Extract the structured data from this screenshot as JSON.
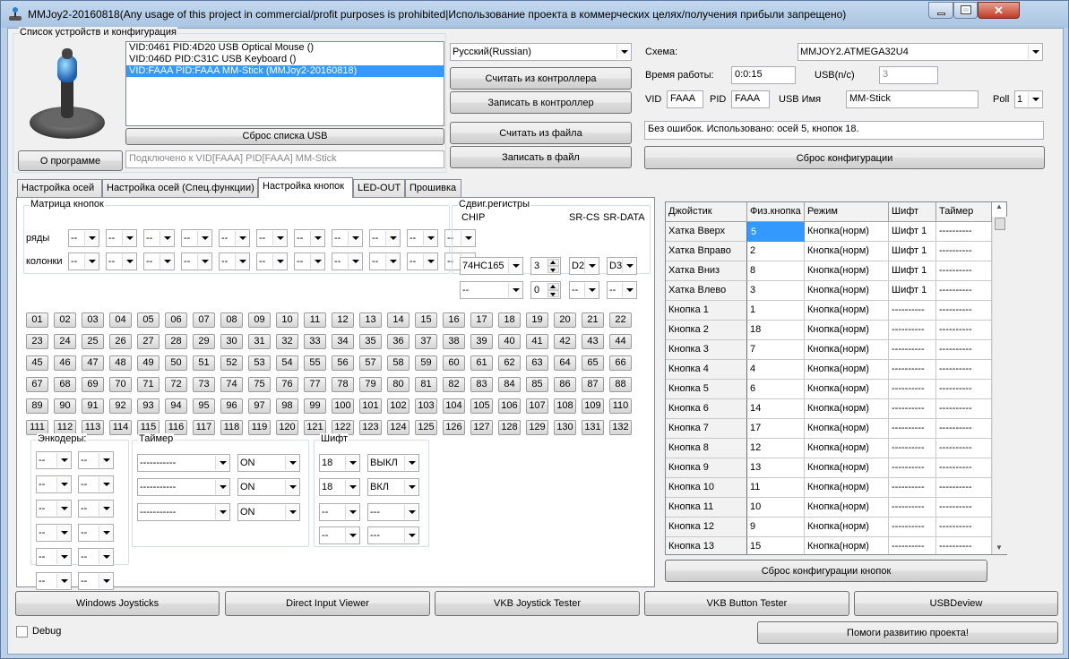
{
  "window": {
    "title": "MMJoy2-20160818(Any usage of this project in commercial/profit purposes is prohibited|Использование проекта в коммерческих целях/получения прибыли запрещено)"
  },
  "devices": {
    "group_title": "Список устройств и конфигурация",
    "list": [
      "VID:0461 PID:4D20 USB Optical Mouse ()",
      "VID:046D PID:C31C USB Keyboard ()",
      "VID:FAAA PID:FAAA MM-Stick (MMJoy2-20160818)"
    ],
    "selected_index": 2,
    "reset_usb_label": "Сброс списка USB",
    "about_label": "О программе",
    "status_text": "Подключено к VID[FAAA] PID[FAAA] MM-Stick"
  },
  "controller": {
    "language": "Русский(Russian)",
    "read_controller": "Считать из контроллера",
    "write_controller": "Записать в контроллер",
    "read_file": "Считать из файла",
    "write_file": "Записать в файл"
  },
  "config": {
    "scheme_label": "Схема:",
    "scheme_value": "MMJOY2.ATMEGA32U4",
    "uptime_label": "Время работы:",
    "uptime_value": "0:0:15",
    "usb_label": "USB(n/c)",
    "usb_value": "3",
    "vid_label": "VID",
    "vid_value": "FAAA",
    "pid_label": "PID",
    "pid_value": "FAAA",
    "usbname_label": "USB Имя",
    "usbname_value": "MM-Stick",
    "poll_label": "Poll",
    "poll_value": "1",
    "status_message": "Без ошибок. Использовано: осей  5, кнопок  18.",
    "reset_config_label": "Сброс конфигурации"
  },
  "tabs": [
    "Настройка осей",
    "Настройка осей (Спец.функции)",
    "Настройка кнопок",
    "LED-OUT",
    "Прошивка"
  ],
  "active_tab": 2,
  "matrix": {
    "title": "Матрица кнопок",
    "rows_label": "ряды",
    "cols_label": "колонки",
    "empty": "--"
  },
  "shift_reg": {
    "title": "Сдвиг.регистры",
    "chip_label": "CHIP",
    "cs_label": "SR-CS",
    "data_label": "SR-DATA",
    "chip1": "74HC165",
    "count1": "3",
    "cs1": "D2",
    "data1": "D3",
    "chip2": "--",
    "count2": "0",
    "cs2": "--",
    "data2": "--"
  },
  "buttons": [
    "01",
    "02",
    "03",
    "04",
    "05",
    "06",
    "07",
    "08",
    "09",
    "10",
    "11",
    "12",
    "13",
    "14",
    "15",
    "16",
    "17",
    "18",
    "19",
    "20",
    "21",
    "22",
    "23",
    "24",
    "25",
    "26",
    "27",
    "28",
    "29",
    "30",
    "31",
    "32",
    "33",
    "34",
    "35",
    "36",
    "37",
    "38",
    "39",
    "40",
    "41",
    "42",
    "43",
    "44",
    "45",
    "46",
    "47",
    "48",
    "49",
    "50",
    "51",
    "52",
    "53",
    "54",
    "55",
    "56",
    "57",
    "58",
    "59",
    "60",
    "61",
    "62",
    "63",
    "64",
    "65",
    "66",
    "67",
    "68",
    "69",
    "70",
    "71",
    "72",
    "73",
    "74",
    "75",
    "76",
    "77",
    "78",
    "79",
    "80",
    "81",
    "82",
    "83",
    "84",
    "85",
    "86",
    "87",
    "88",
    "89",
    "90",
    "91",
    "92",
    "93",
    "94",
    "95",
    "96",
    "97",
    "98",
    "99",
    "100",
    "101",
    "102",
    "103",
    "104",
    "105",
    "106",
    "107",
    "108",
    "109",
    "110",
    "111",
    "112",
    "113",
    "114",
    "115",
    "116",
    "117",
    "118",
    "119",
    "120",
    "121",
    "122",
    "123",
    "124",
    "125",
    "126",
    "127",
    "128",
    "129",
    "130",
    "131",
    "132"
  ],
  "encoders": {
    "title": "Энкодеры:",
    "value": "--"
  },
  "timer": {
    "title": "Таймер",
    "dash": "-----------",
    "rows": [
      "ON",
      "ON",
      "ON"
    ]
  },
  "shift": {
    "title": "Шифт",
    "rows": [
      [
        "18",
        "ВЫКЛ"
      ],
      [
        "18",
        "ВКЛ"
      ],
      [
        "--",
        "---"
      ],
      [
        "--",
        "---"
      ]
    ]
  },
  "grid": {
    "headers": [
      "Джойстик",
      "Физ.кнопка",
      "Режим",
      "Шифт",
      "Таймер"
    ],
    "rows": [
      [
        "Хатка Вверх",
        "5",
        "Кнопка(норм)",
        "Шифт 1",
        "----------"
      ],
      [
        "Хатка Вправо",
        "2",
        "Кнопка(норм)",
        "Шифт 1",
        "----------"
      ],
      [
        "Хатка Вниз",
        "8",
        "Кнопка(норм)",
        "Шифт 1",
        "----------"
      ],
      [
        "Хатка Влево",
        "3",
        "Кнопка(норм)",
        "Шифт 1",
        "----------"
      ],
      [
        "Кнопка 1",
        "1",
        "Кнопка(норм)",
        "----------",
        "----------"
      ],
      [
        "Кнопка 2",
        "18",
        "Кнопка(норм)",
        "----------",
        "----------"
      ],
      [
        "Кнопка 3",
        "7",
        "Кнопка(норм)",
        "----------",
        "----------"
      ],
      [
        "Кнопка 4",
        "4",
        "Кнопка(норм)",
        "----------",
        "----------"
      ],
      [
        "Кнопка 5",
        "6",
        "Кнопка(норм)",
        "----------",
        "----------"
      ],
      [
        "Кнопка 6",
        "14",
        "Кнопка(норм)",
        "----------",
        "----------"
      ],
      [
        "Кнопка 7",
        "17",
        "Кнопка(норм)",
        "----------",
        "----------"
      ],
      [
        "Кнопка 8",
        "12",
        "Кнопка(норм)",
        "----------",
        "----------"
      ],
      [
        "Кнопка 9",
        "13",
        "Кнопка(норм)",
        "----------",
        "----------"
      ],
      [
        "Кнопка 10",
        "11",
        "Кнопка(норм)",
        "----------",
        "----------"
      ],
      [
        "Кнопка 11",
        "10",
        "Кнопка(норм)",
        "----------",
        "----------"
      ],
      [
        "Кнопка 12",
        "9",
        "Кнопка(норм)",
        "----------",
        "----------"
      ],
      [
        "Кнопка 13",
        "15",
        "Кнопка(норм)",
        "----------",
        "----------"
      ]
    ],
    "reset_label": "Сброс конфигурации кнопок"
  },
  "tools": [
    "Windows Joysticks",
    "Direct Input Viewer",
    "VKB Joystick Tester",
    "VKB Button Tester",
    "USBDeview"
  ],
  "debug_label": "Debug",
  "help_label": "Помоги развитию проекта!"
}
